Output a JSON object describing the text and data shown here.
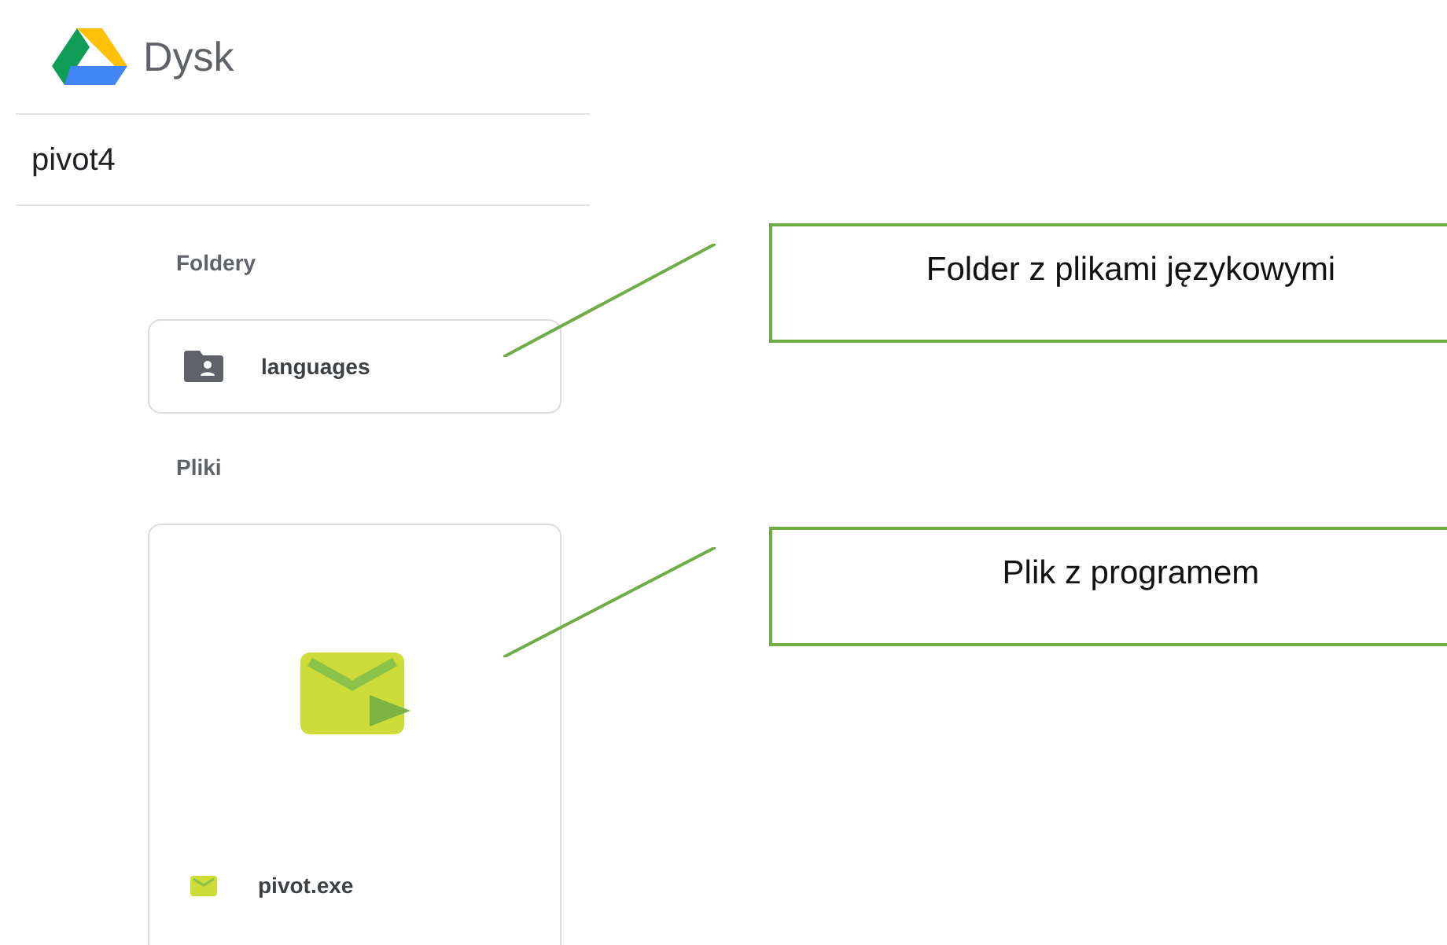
{
  "app": {
    "name": "Dysk"
  },
  "folder_title": "pivot4",
  "sections": [
    {
      "heading": "Foldery",
      "items": [
        {
          "kind": "folder",
          "name": "languages"
        }
      ]
    },
    {
      "heading": "Pliki",
      "items": [
        {
          "kind": "file",
          "name": "pivot.exe"
        }
      ]
    }
  ],
  "callouts": [
    {
      "text": "Folder z plikami językowymi"
    },
    {
      "text": "Plik z programem"
    }
  ]
}
